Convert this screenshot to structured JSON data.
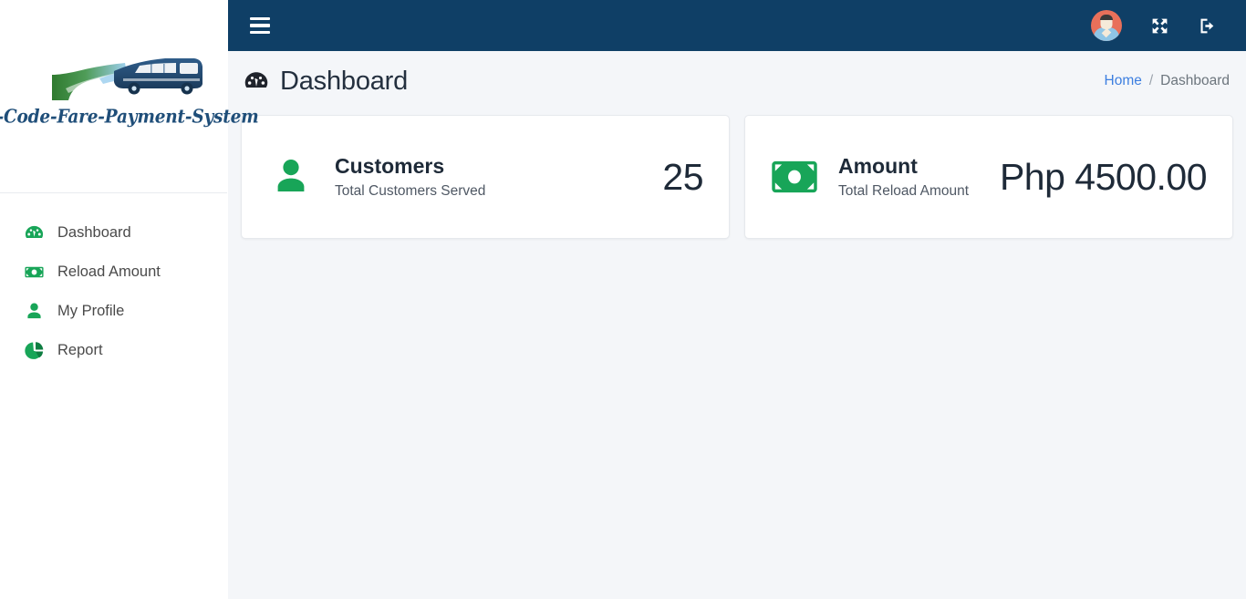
{
  "brand": {
    "wordmark": "QR-Code-Fare-Payment-System",
    "logo_icon": "bus-road-logo"
  },
  "sidebar": {
    "items": [
      {
        "label": "Dashboard",
        "icon": "tachometer-icon"
      },
      {
        "label": "Reload Amount",
        "icon": "money-bill-icon"
      },
      {
        "label": "My Profile",
        "icon": "user-icon"
      },
      {
        "label": "Report",
        "icon": "pie-chart-icon"
      }
    ]
  },
  "topbar": {
    "menu_toggle": "hamburger-icon",
    "avatar": "user-avatar",
    "fullscreen": "expand-arrows-icon",
    "logout": "sign-out-icon"
  },
  "page": {
    "title": "Dashboard",
    "title_icon": "tachometer-icon"
  },
  "breadcrumb": {
    "home": "Home",
    "separator": "/",
    "current": "Dashboard"
  },
  "cards": [
    {
      "icon": "user-icon",
      "title": "Customers",
      "subtitle": "Total Customers Served",
      "value": "25"
    },
    {
      "icon": "money-bill-icon",
      "title": "Amount",
      "subtitle": "Total Reload Amount",
      "value": "Php 4500.00"
    }
  ],
  "colors": {
    "header_navy": "#0f3f66",
    "accent_green": "#18a558",
    "page_bg": "#f4f6f9",
    "link_blue": "#3d7fe0",
    "brand_text": "#1f4e79",
    "avatar_bg": "#e8705a"
  }
}
